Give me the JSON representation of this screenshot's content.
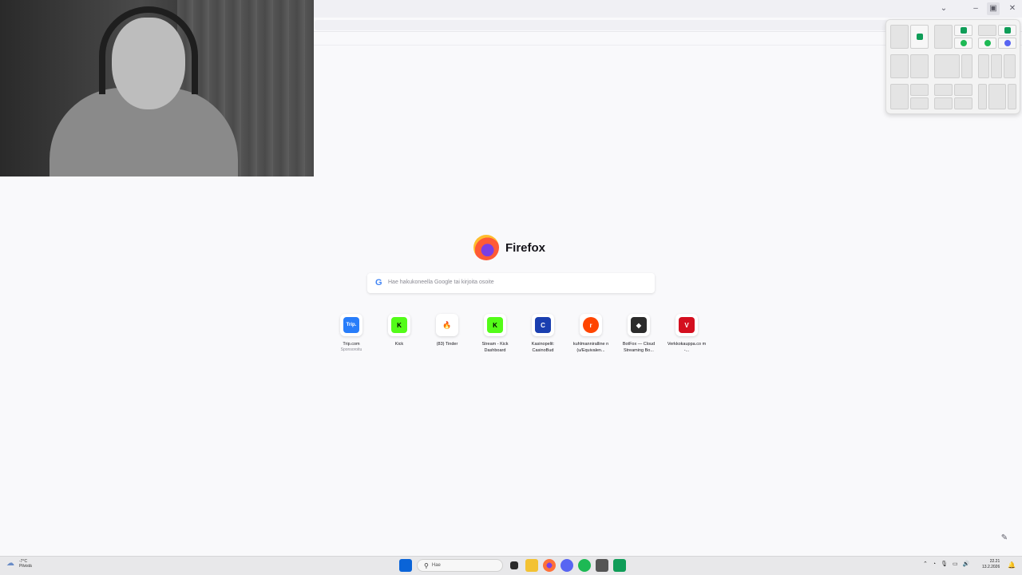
{
  "window": {
    "controls": {
      "dropdown": "⌄",
      "minimize": "–",
      "snap": "▣",
      "close": "✕"
    }
  },
  "snap_popup": {
    "app_colors": {
      "game": "#0f9d58",
      "spotify": "#1db954",
      "discord": "#5865f2"
    }
  },
  "newtab": {
    "brand": "Firefox",
    "search_placeholder": "Hae hakukoneella Google tai kirjoita osoite",
    "google_glyph": "G",
    "edit_icon": "✎"
  },
  "top_sites": [
    {
      "label": "Trip.com",
      "sublabel": "Sponsoroitu",
      "glyph": "Trip.",
      "color": "#287dfa",
      "icon": "trip-icon"
    },
    {
      "label": "Kick",
      "sublabel": "",
      "glyph": "K",
      "color": "#53fc18",
      "icon": "kick-icon"
    },
    {
      "label": "(83) Tinder",
      "sublabel": "",
      "glyph": "🔥",
      "color": "#fe3c72",
      "icon": "tinder-icon"
    },
    {
      "label": "Stream - Kick Dashboard",
      "sublabel": "",
      "glyph": "K",
      "color": "#53fc18",
      "icon": "kick-icon"
    },
    {
      "label": "Kasinopelit: CasinoBud",
      "sublabel": "",
      "glyph": "C",
      "color": "#1a3fb0",
      "icon": "casinobud-icon"
    },
    {
      "label": "kuhlmanniralline n (u/Equivalen...",
      "sublabel": "",
      "glyph": "r",
      "color": "#ff4500",
      "icon": "reddit-icon"
    },
    {
      "label": "BotFox — Cloud Streaming Bo...",
      "sublabel": "",
      "glyph": "◆",
      "color": "#2b2b2b",
      "icon": "botfox-icon"
    },
    {
      "label": "Verkkokauppa.co m -...",
      "sublabel": "",
      "glyph": "V",
      "color": "#d40f1f",
      "icon": "verkkokauppa-icon"
    }
  ],
  "taskbar": {
    "weather": {
      "temp": "-7°C",
      "condition": "Pilvistä"
    },
    "search_label": "Hae",
    "clock": {
      "time": "22.21",
      "date": "13.2.2026"
    },
    "tray": {
      "chevron": "⌃",
      "volume": "🔊"
    }
  }
}
